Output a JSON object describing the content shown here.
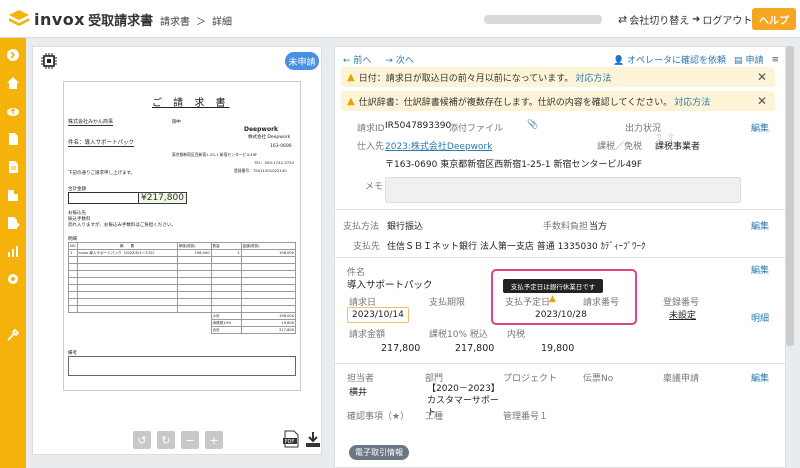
{
  "header": {
    "brand": "invox",
    "brand_sub": "受取請求書",
    "breadcrumb": [
      "請求書",
      "＞",
      "詳細"
    ],
    "switch_company": "会社切り替え",
    "logout": "ログアウト",
    "help": "ヘルプ"
  },
  "sidebar": {
    "icons": [
      "arrow-right-icon",
      "home-icon",
      "cloud-upload-icon",
      "document-icon",
      "document-list-icon",
      "building-icon",
      "export-icon",
      "chart-icon",
      "gear-icon",
      "tools-icon"
    ]
  },
  "doc_panel": {
    "status": "未申請",
    "paper": {
      "title": "ご 請 求 書",
      "to": "株式会社みかん商事",
      "to_suffix": "御中",
      "subject": "件名：導入サポートパック",
      "company_logo": "Deepwork",
      "company_name": "株式会社 Deepwork",
      "postal": "163-0690",
      "address": "東京都新宿区西新宿1-25-1 新宿センタービル49F",
      "tel": "TEL：050-1742-3724",
      "reg_no": "登録番号：T5011201022140",
      "intro": "下記の通りご請求申し上げます。",
      "total_label": "合計金額",
      "total": "¥217,800",
      "pay_label": "お振込先",
      "pay_note": "振込手数料",
      "note": "恐れ入りますが、お振込み手数料はご負担ください。",
      "detail_label": "明細",
      "table_header": [
        "NO",
        "摘　　要",
        "単価(税抜)",
        "数量",
        "金額(税抜)"
      ],
      "table_row": [
        "1",
        "invox 導入サポートパック（2022/5/1〜7/31）",
        "198,000",
        "1",
        "198,000"
      ],
      "subtotal_label": "小計",
      "subtotal": "198,000",
      "tax_label": "消費税10%",
      "tax": "19,800",
      "sum_label": "合計",
      "sum": "217,800",
      "remarks_label": "備考"
    }
  },
  "main": {
    "nav": {
      "prev": "前へ",
      "next": "次へ",
      "operator": "オペレータに確認を依頼",
      "apply": "申請"
    },
    "alerts": [
      {
        "text": "日付：請求日が取込日の前々月以前になっています。",
        "link": "対応方法"
      },
      {
        "text": "仕訳辞書：仕訳辞書候補が複数存在します。仕訳の内容を確認してください。",
        "link": "対応方法"
      }
    ],
    "invoice": {
      "id_label": "請求ID",
      "id": "IR5047893390",
      "attach_label": "添付ファイル",
      "output_label": "出力状況",
      "vendor_label": "仕入先",
      "vendor": "2023:株式会社Deepwork",
      "tax_type_label": "課税／免税",
      "tax_type": "課税事業者",
      "vendor_address": "〒163-0690 東京都新宿区西新宿1-25-1 新宿センタービル49F",
      "memo_label": "メモ",
      "edit": "編集"
    },
    "payment": {
      "method_label": "支払方法",
      "method": "銀行振込",
      "fee_label": "手数料負担",
      "fee": "当方",
      "dest_label": "支払先",
      "dest": "住信ＳＢＩネット銀行 法人第一支店 普通 1335030 ｶﾃﾞｨｰﾌﾟﾜｰｸ"
    },
    "details": {
      "subject_label": "件名",
      "subject": "導入サポートパック",
      "tooltip": "支払予定日は銀行休業日です",
      "invoice_date_label": "請求日",
      "invoice_date": "2023/10/14",
      "deadline_label": "支払期限",
      "pay_date_label": "支払予定日",
      "pay_date": "2023/10/28",
      "invoice_no_label": "請求番号",
      "reg_label": "登録番号",
      "reg": "未設定",
      "amount_label": "請求金額",
      "amount": "217,800",
      "tax10_label": "課税10% 税込",
      "tax10": "217,800",
      "inner_tax_label": "内税",
      "inner_tax": "19,800",
      "detail_link": "明細"
    },
    "assign": {
      "owner_label": "担当者",
      "owner": "横井",
      "dept_label": "部門",
      "dept": "【2020－2023】カスタマーサポート",
      "project_label": "プロジェクト",
      "slip_label": "伝票No",
      "approval_label": "稟議申請",
      "confirm_label": "確認事項（★）",
      "work_label": "工種",
      "mgmt_label": "管理番号１"
    },
    "tag": "電子取引情報"
  }
}
